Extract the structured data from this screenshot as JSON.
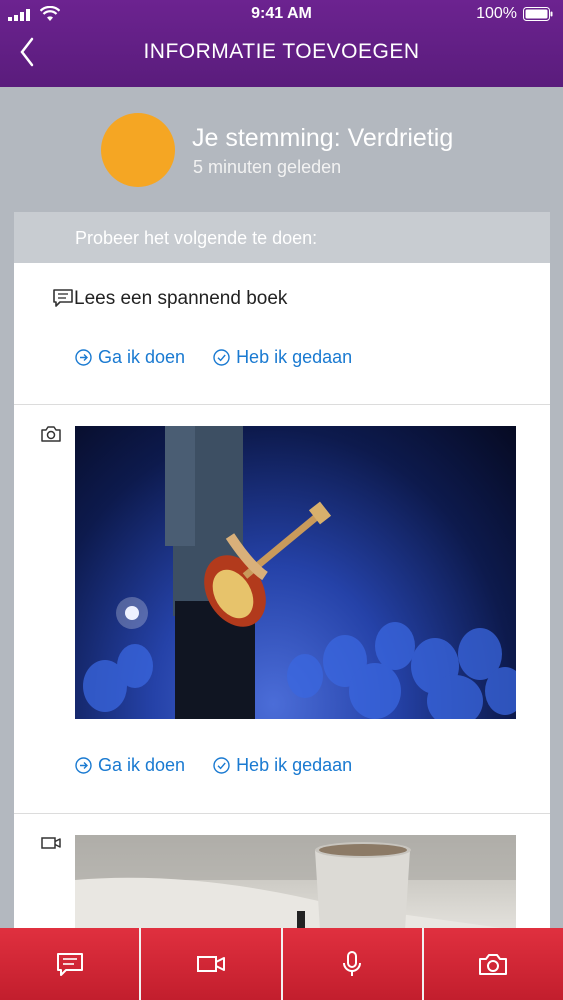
{
  "status_bar": {
    "time": "9:41 AM",
    "battery": "100%"
  },
  "header": {
    "title": "INFORMATIE TOEVOEGEN",
    "back_icon": "chevron-left-icon"
  },
  "mood": {
    "title": "Je stemming: Verdrietig",
    "time": "5 minuten geleden",
    "color": "#f5a623"
  },
  "suggestions": {
    "heading": "Probeer het volgende te doen:",
    "items": [
      {
        "type": "text",
        "icon": "chat-icon",
        "text": "Lees een spannend boek",
        "go_label": "Ga ik doen",
        "done_label": "Heb ik gedaan"
      },
      {
        "type": "photo",
        "icon": "camera-icon",
        "image": "guitarist-concert-photo",
        "go_label": "Ga ik doen",
        "done_label": "Heb ik gedaan"
      },
      {
        "type": "video",
        "icon": "video-icon",
        "image": "coffee-cup-photo"
      }
    ]
  },
  "toolbar": {
    "items": [
      "chat-icon",
      "video-icon",
      "microphone-icon",
      "camera-icon"
    ]
  },
  "colors": {
    "header": "#6c2390",
    "accent": "#1a7ad1",
    "toolbar": "#d62a39"
  }
}
